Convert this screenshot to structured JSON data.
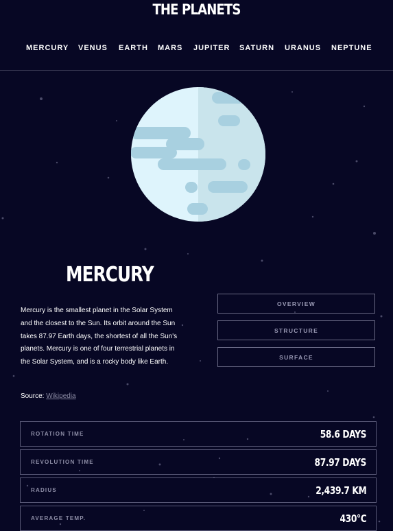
{
  "header": {
    "title": "THE PLANETS"
  },
  "nav": {
    "items": [
      "MERCURY",
      "VENUS",
      "EARTH",
      "MARS",
      "JUPITER",
      "SATURN",
      "URANUS",
      "NEPTUNE"
    ]
  },
  "planet": {
    "name": "MERCURY",
    "description": "Mercury is the smallest planet in the Solar System and the closest to the Sun. Its orbit around the Sun takes 87.97 Earth days, the shortest of all the Sun's planets. Mercury is one of four terrestrial planets in the Solar System, and is a rocky body like Earth.",
    "source_label": "Source:",
    "source_link": "Wikipedia"
  },
  "tabs": [
    "OVERVIEW",
    "STRUCTURE",
    "SURFACE"
  ],
  "stats": [
    {
      "label": "ROTATION TIME",
      "value": "58.6 DAYS"
    },
    {
      "label": "REVOLUTION TIME",
      "value": "87.97 DAYS"
    },
    {
      "label": "RADIUS",
      "value": "2,439.7 KM"
    },
    {
      "label": "AVERAGE TEMP.",
      "value": "430°C"
    }
  ],
  "colors": {
    "background": "#070724",
    "planet_light": "#def4fc",
    "planet_shadow": "#a8d0e0",
    "border": "#5a5a78",
    "label": "#8f8fa8"
  }
}
